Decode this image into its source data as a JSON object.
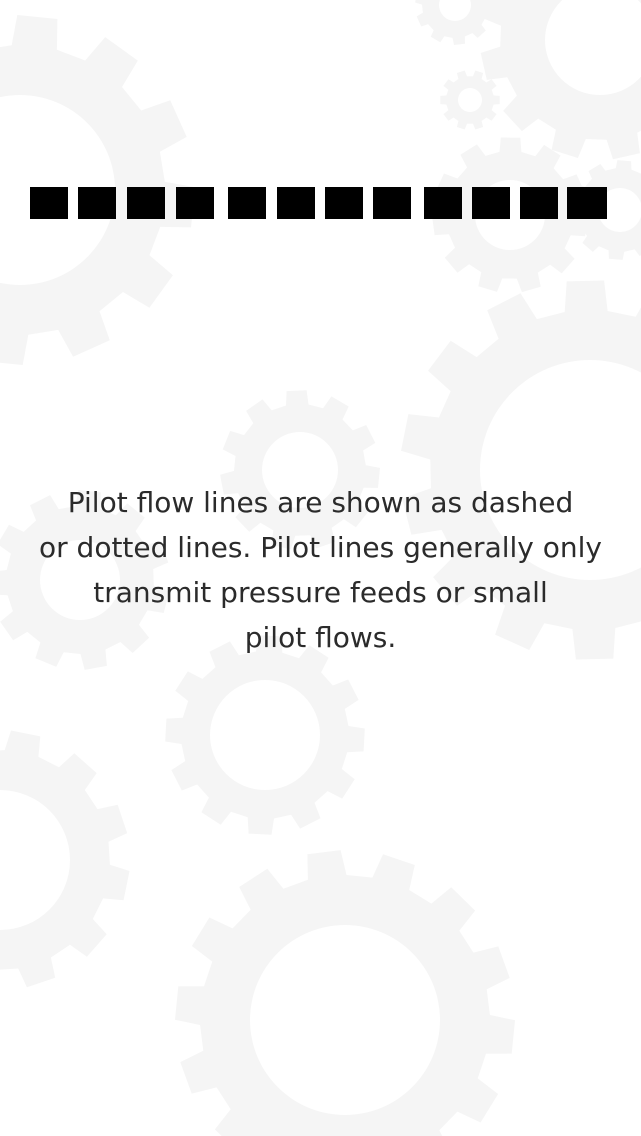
{
  "background": {
    "color": "#ffffff",
    "pattern_icon": "gear-icon",
    "pattern_color": "#f5f5f5"
  },
  "pilot_line_symbol": {
    "icon": "dashed-line-icon",
    "color": "#000000"
  },
  "caption": {
    "lines": [
      "Pilot flow lines are shown as dashed",
      "or dotted lines. Pilot lines generally only",
      "transmit pressure feeds or small",
      "pilot flows."
    ],
    "color": "#2b2b2b"
  }
}
